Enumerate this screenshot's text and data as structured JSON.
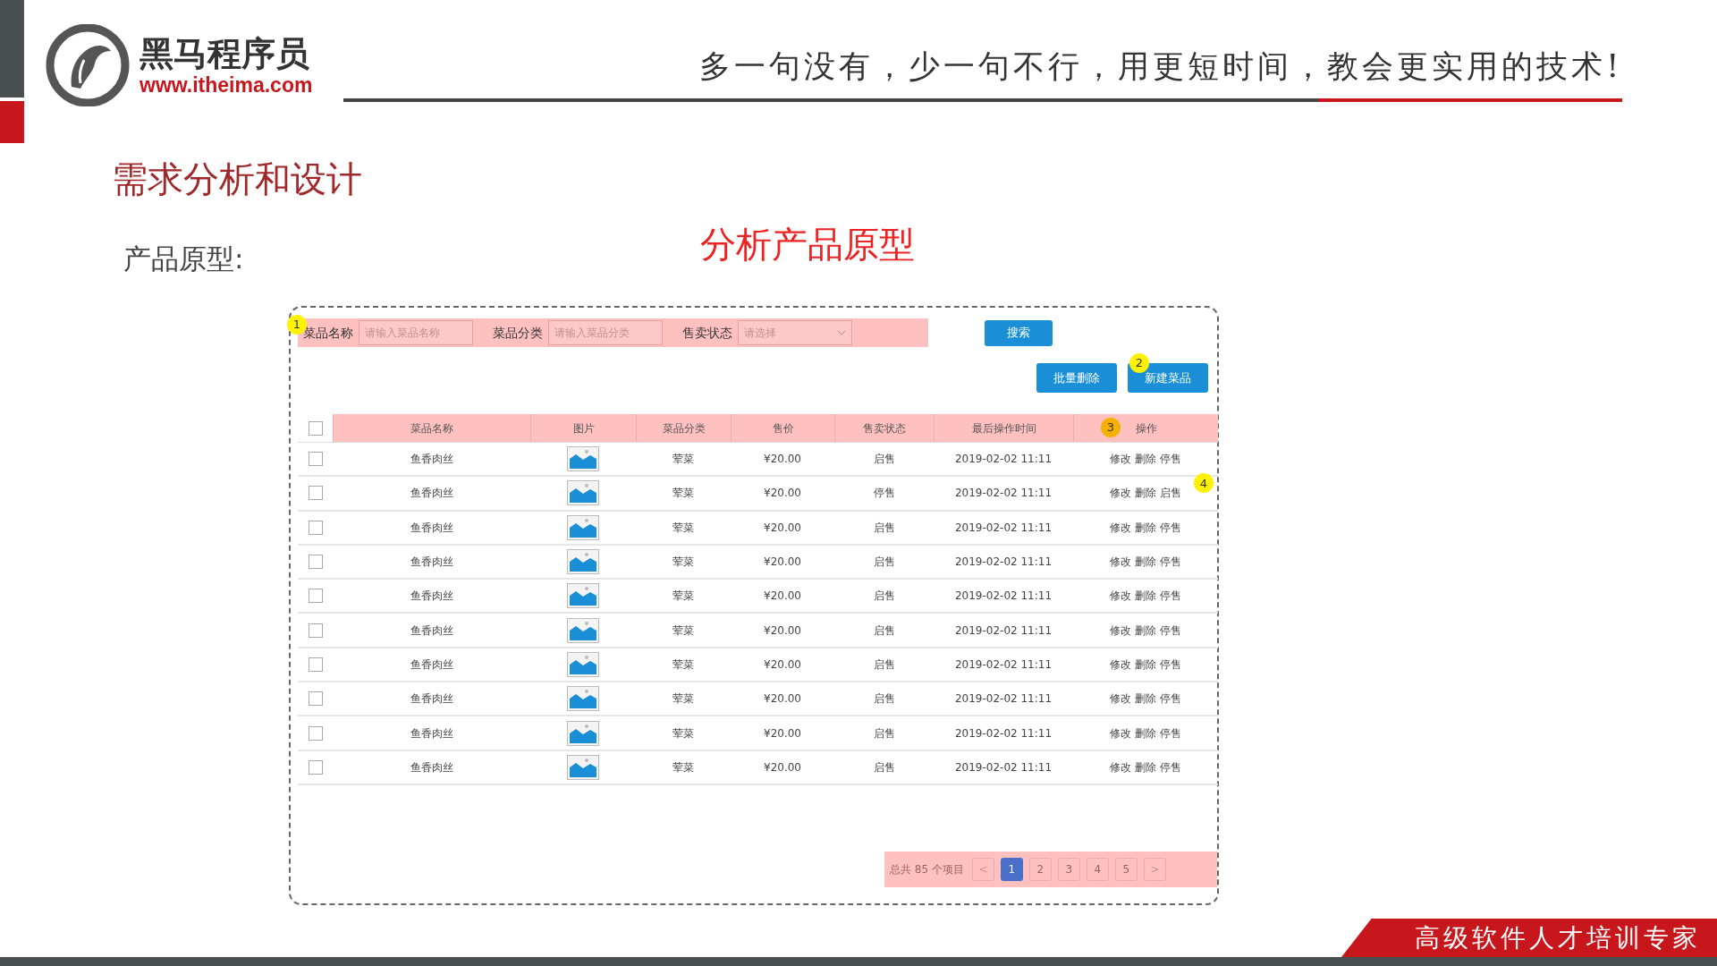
{
  "header": {
    "brand_name": "黑马程序员",
    "brand_url": "www.itheima.com",
    "slogan": "多一句没有，少一句不行，用更短时间，教会更实用的技术!"
  },
  "slide_title": "需求分析和设计",
  "section_label": "产品原型:",
  "annotation": "分析产品原型",
  "prototype": {
    "filters_marker": "1",
    "filters": [
      {
        "label": "菜品名称",
        "placeholder": "请输入菜品名称",
        "kind": "text"
      },
      {
        "label": "菜品分类",
        "placeholder": "请输入菜品分类",
        "kind": "text"
      },
      {
        "label": "售卖状态",
        "placeholder": "请选择",
        "kind": "select"
      }
    ],
    "search_button": "搜索",
    "actions_marker": "2",
    "actions": [
      "批量删除",
      "新建菜品"
    ],
    "table": {
      "header_checked": false,
      "header_marker": "3",
      "row_marker": "4",
      "columns": [
        "菜品名称",
        "图片",
        "菜品分类",
        "售价",
        "售卖状态",
        "最后操作时间",
        "操作"
      ],
      "rows": [
        {
          "checked": false,
          "name": "鱼香肉丝",
          "category": "荤菜",
          "price": "¥20.00",
          "status": "启售",
          "time": "2019-02-02 11:11",
          "ops": [
            "修改",
            "删除",
            "停售"
          ]
        },
        {
          "checked": false,
          "name": "鱼香肉丝",
          "category": "荤菜",
          "price": "¥20.00",
          "status": "停售",
          "time": "2019-02-02 11:11",
          "ops": [
            "修改",
            "删除",
            "启售"
          ]
        },
        {
          "checked": false,
          "name": "鱼香肉丝",
          "category": "荤菜",
          "price": "¥20.00",
          "status": "启售",
          "time": "2019-02-02 11:11",
          "ops": [
            "修改",
            "删除",
            "停售"
          ]
        },
        {
          "checked": false,
          "name": "鱼香肉丝",
          "category": "荤菜",
          "price": "¥20.00",
          "status": "启售",
          "time": "2019-02-02 11:11",
          "ops": [
            "修改",
            "删除",
            "停售"
          ]
        },
        {
          "checked": false,
          "name": "鱼香肉丝",
          "category": "荤菜",
          "price": "¥20.00",
          "status": "启售",
          "time": "2019-02-02 11:11",
          "ops": [
            "修改",
            "删除",
            "停售"
          ]
        },
        {
          "checked": false,
          "name": "鱼香肉丝",
          "category": "荤菜",
          "price": "¥20.00",
          "status": "启售",
          "time": "2019-02-02 11:11",
          "ops": [
            "修改",
            "删除",
            "停售"
          ]
        },
        {
          "checked": false,
          "name": "鱼香肉丝",
          "category": "荤菜",
          "price": "¥20.00",
          "status": "启售",
          "time": "2019-02-02 11:11",
          "ops": [
            "修改",
            "删除",
            "停售"
          ]
        },
        {
          "checked": false,
          "name": "鱼香肉丝",
          "category": "荤菜",
          "price": "¥20.00",
          "status": "启售",
          "time": "2019-02-02 11:11",
          "ops": [
            "修改",
            "删除",
            "停售"
          ]
        },
        {
          "checked": false,
          "name": "鱼香肉丝",
          "category": "荤菜",
          "price": "¥20.00",
          "status": "启售",
          "time": "2019-02-02 11:11",
          "ops": [
            "修改",
            "删除",
            "停售"
          ]
        },
        {
          "checked": false,
          "name": "鱼香肉丝",
          "category": "荤菜",
          "price": "¥20.00",
          "status": "启售",
          "time": "2019-02-02 11:11",
          "ops": [
            "修改",
            "删除",
            "停售"
          ]
        }
      ]
    },
    "pagination": {
      "total": "总共 85 个项目",
      "prev": "<",
      "next": ">",
      "pages": [
        {
          "label": "1",
          "selected": true
        },
        {
          "label": "2",
          "selected": false
        },
        {
          "label": "3",
          "selected": false
        },
        {
          "label": "4",
          "selected": false
        },
        {
          "label": "5",
          "selected": false
        }
      ]
    }
  },
  "footer_banner": "高级软件人才培训专家"
}
